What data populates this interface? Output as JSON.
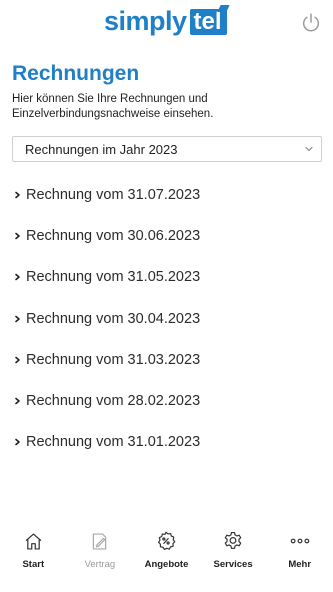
{
  "brand": {
    "name_part1": "simply",
    "name_part2": "tel",
    "color": "#1f7fc7"
  },
  "header": {
    "power_icon": "power-icon"
  },
  "page": {
    "title": "Rechnungen",
    "intro": "Hier können Sie Ihre Rechnungen und Einzelverbindungsnachweise einsehen."
  },
  "year_select": {
    "selected": "Rechnungen im Jahr 2023",
    "icon": "chevron-down-icon"
  },
  "invoices": [
    {
      "label": "Rechnung vom 31.07.2023"
    },
    {
      "label": "Rechnung vom 30.06.2023"
    },
    {
      "label": "Rechnung vom 31.05.2023"
    },
    {
      "label": "Rechnung vom 30.04.2023"
    },
    {
      "label": "Rechnung vom 31.03.2023"
    },
    {
      "label": "Rechnung vom 28.02.2023"
    },
    {
      "label": "Rechnung vom 31.01.2023"
    }
  ],
  "tabbar": {
    "items": [
      {
        "label": "Start",
        "icon": "home-icon",
        "enabled": true
      },
      {
        "label": "Vertrag",
        "icon": "contract-icon",
        "enabled": false
      },
      {
        "label": "Angebote",
        "icon": "offer-badge-icon",
        "enabled": true
      },
      {
        "label": "Services",
        "icon": "gear-icon",
        "enabled": true
      },
      {
        "label": "Mehr",
        "icon": "more-icon",
        "enabled": true
      }
    ]
  }
}
